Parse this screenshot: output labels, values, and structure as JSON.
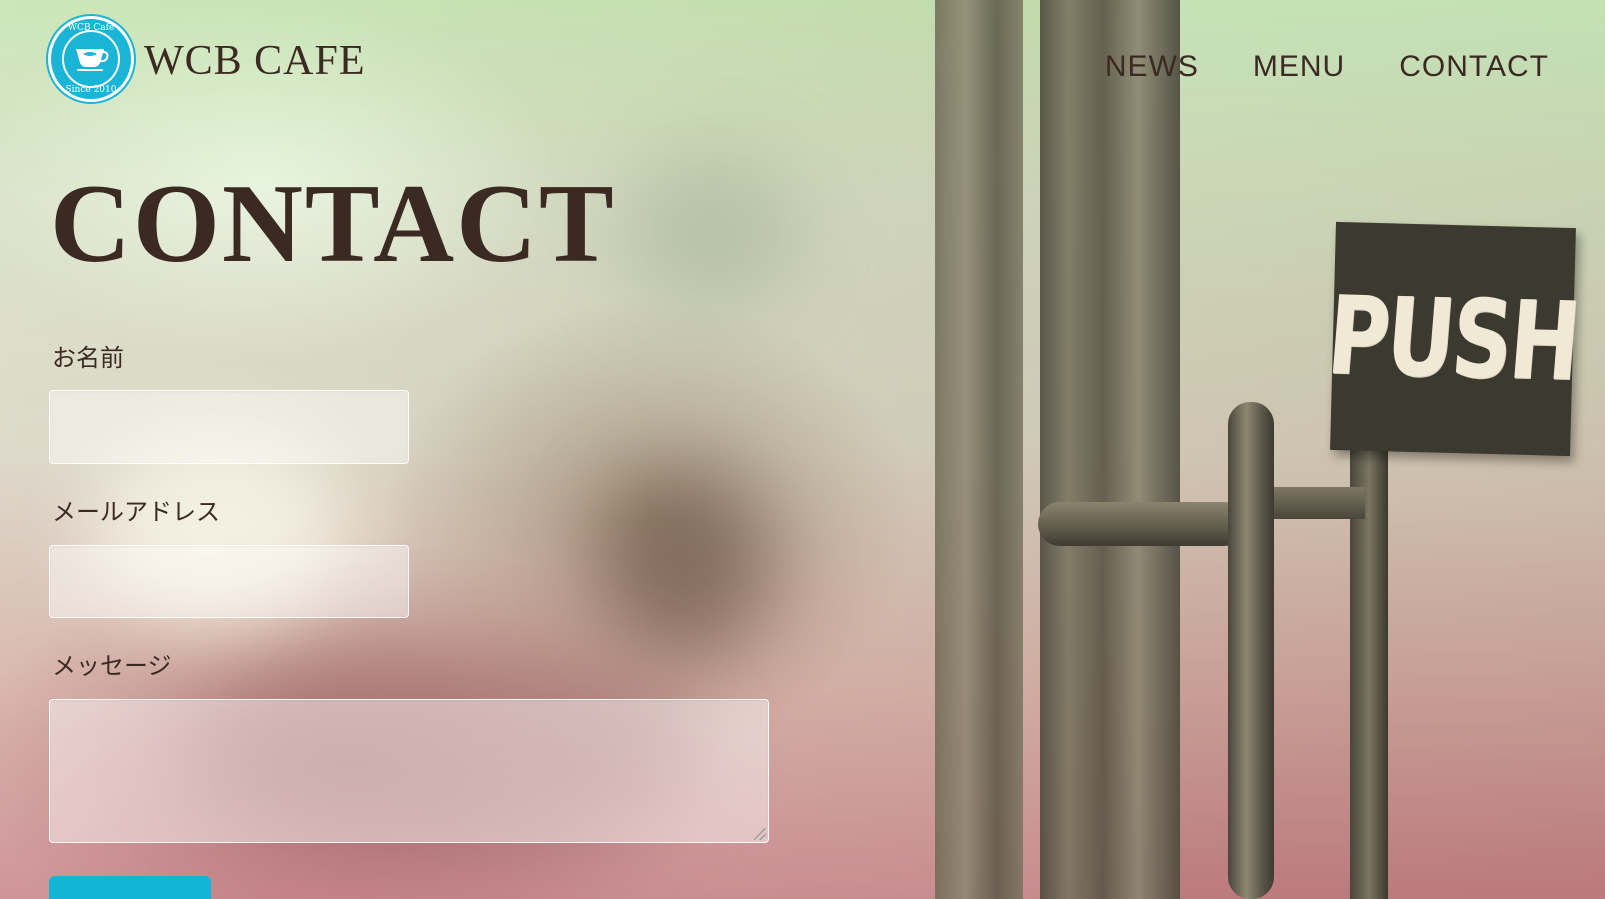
{
  "brand": {
    "name": "WCB CAFE",
    "badge_top": "WCB Cafe",
    "badge_bottom": "Since 2010",
    "badge_color": "#1ab4d6"
  },
  "nav": {
    "items": [
      "NEWS",
      "MENU",
      "CONTACT"
    ]
  },
  "page": {
    "title": "CONTACT"
  },
  "form": {
    "name_label": "お名前",
    "name_value": "",
    "email_label": "メールアドレス",
    "email_value": "",
    "message_label": "メッセージ",
    "message_value": "",
    "submit_label": "",
    "submit_color": "#12b5d6"
  },
  "background": {
    "sign_text": "PUSH"
  }
}
